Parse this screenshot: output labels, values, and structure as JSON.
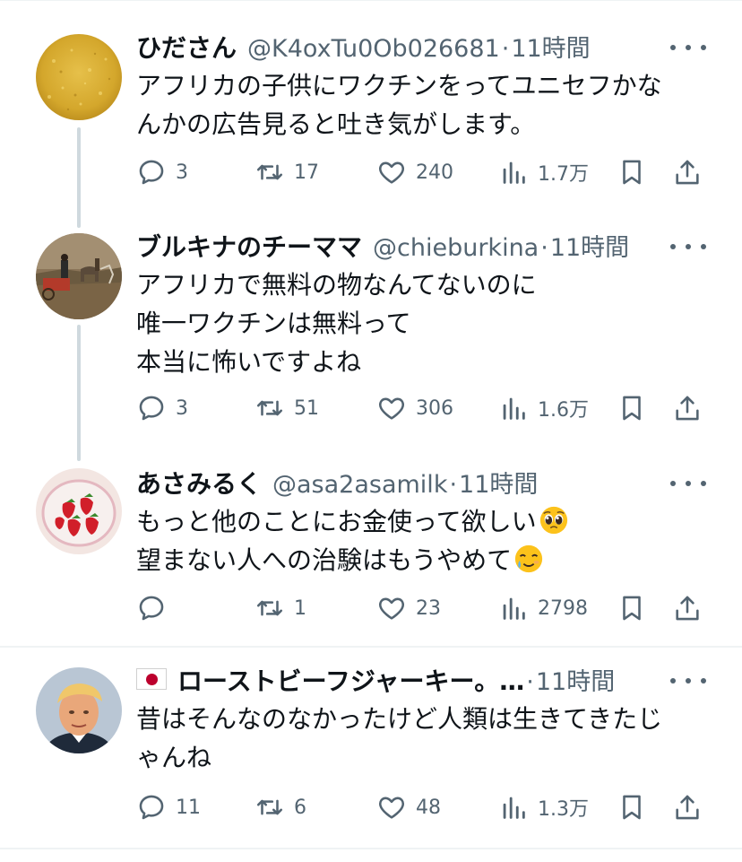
{
  "tweets": [
    {
      "name": "ひださん",
      "handle": "@K4oxTu0Ob026681",
      "separator": "·",
      "time": "11時間",
      "lines": [
        "アフリカの子供にワクチンをってユニセフかな",
        "んかの広告見ると吐き気がします。"
      ],
      "replies": "3",
      "retweets": "17",
      "likes": "240",
      "views": "1.7万",
      "avatar_icon": "yellow-texture-avatar"
    },
    {
      "name": "ブルキナのチーママ",
      "handle": "@chieburkina",
      "separator": "·",
      "time": "11時間",
      "lines": [
        "アフリカで無料の物なんてないのに",
        "唯一ワクチンは無料って",
        "本当に怖いですよね"
      ],
      "replies": "3",
      "retweets": "51",
      "likes": "306",
      "views": "1.6万",
      "avatar_icon": "donkey-cart-avatar"
    },
    {
      "name": "あさみるく",
      "handle": "@asa2asamilk",
      "separator": "·",
      "time": "11時間",
      "lines": [
        "もっと他のことにお金使って欲しい",
        "望まない人への治験はもうやめて"
      ],
      "replies": "",
      "retweets": "1",
      "likes": "23",
      "views": "2798",
      "avatar_icon": "strawberries-avatar",
      "emojis": [
        "pleading-face-emoji",
        "smiling-face-with-tear-emoji"
      ]
    },
    {
      "name": "ローストビーフジャーキー。…",
      "handle": "",
      "separator": "·",
      "time": "11時間",
      "lines": [
        "昔はそんなのなかったけど人類は生きてきたじ",
        "ゃんね"
      ],
      "replies": "11",
      "retweets": "6",
      "likes": "48",
      "views": "1.3万",
      "avatar_icon": "man-portrait-avatar",
      "name_prefix_icon": "japan-flag-icon"
    }
  ],
  "colors": {
    "text": "#0f1419",
    "secondary": "#536471",
    "thread_line": "#cfd9de",
    "divider": "#eff3f4"
  }
}
